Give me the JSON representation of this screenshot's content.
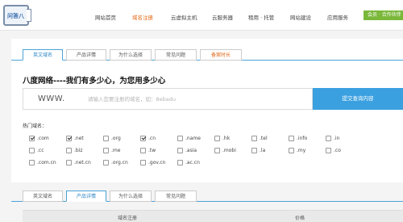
{
  "header": {
    "logo_text": "问答八",
    "nav": [
      {
        "label": "网站首页",
        "active": false
      },
      {
        "label": "域名注册",
        "active": true
      },
      {
        "label": "云虚拟主机",
        "active": false
      },
      {
        "label": "云服务器",
        "active": false
      },
      {
        "label": "租用 · 托管",
        "active": false
      },
      {
        "label": "网站建设",
        "active": false
      },
      {
        "label": "应用服务",
        "active": false
      }
    ],
    "right_button": "会员 · 合作伙伴"
  },
  "tabs_top": [
    {
      "label": "英文域名",
      "active": true
    },
    {
      "label": "产品详情",
      "active": false
    },
    {
      "label": "为什么选择",
      "active": false
    },
    {
      "label": "常见问题",
      "active": false
    },
    {
      "label": "备案时长",
      "active": false,
      "promo": true
    }
  ],
  "headline": "八度网络----我们有多少心，为您用多少心",
  "search": {
    "prefix": "WWW.",
    "placeholder": "请输入您要注册的域名，如：8ebadu",
    "button": "提交查询内容"
  },
  "hot_label": "热门域名：",
  "extensions": [
    [
      {
        "ext": ".com",
        "checked": true
      },
      {
        "ext": ".net",
        "checked": true
      },
      {
        "ext": ".org",
        "checked": false
      },
      {
        "ext": ".cn",
        "checked": true
      },
      {
        "ext": ".name",
        "checked": false
      },
      {
        "ext": ".hk",
        "checked": false
      },
      {
        "ext": ".tel",
        "checked": false
      },
      {
        "ext": ".info",
        "checked": false
      },
      {
        "ext": ".in",
        "checked": false
      }
    ],
    [
      {
        "ext": ".cc",
        "checked": false
      },
      {
        "ext": ".biz",
        "checked": false
      },
      {
        "ext": ".me",
        "checked": false
      },
      {
        "ext": ".tw",
        "checked": false
      },
      {
        "ext": ".asia",
        "checked": false
      },
      {
        "ext": ".mobi",
        "checked": false
      },
      {
        "ext": ".la",
        "checked": false
      },
      {
        "ext": ".my",
        "checked": false
      },
      {
        "ext": ".co",
        "checked": false
      }
    ],
    [
      {
        "ext": ".com.cn",
        "checked": false
      },
      {
        "ext": ".net.cn",
        "checked": false
      },
      {
        "ext": ".org.cn",
        "checked": false
      },
      {
        "ext": ".gov.cn",
        "checked": false
      },
      {
        "ext": ".ac.cn",
        "checked": false
      }
    ]
  ],
  "tabs_bottom": [
    {
      "label": "英文域名",
      "active": false
    },
    {
      "label": "产品详情",
      "active": true
    },
    {
      "label": "为什么选择",
      "active": false
    },
    {
      "label": "常见问题",
      "active": false
    }
  ],
  "table": {
    "headers": [
      "域名注册",
      "价格"
    ]
  },
  "colors": {
    "accent_blue": "#3ba0e0",
    "accent_orange": "#e36a1b",
    "accent_green": "#7ab83a"
  }
}
